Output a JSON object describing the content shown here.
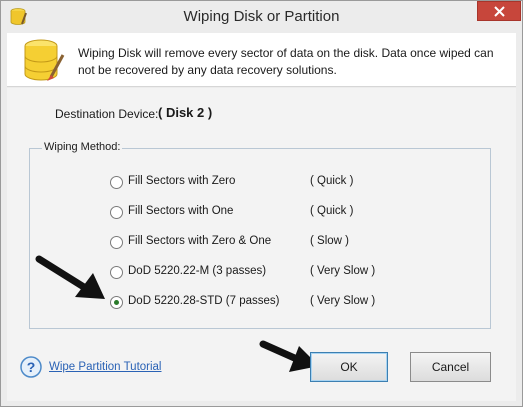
{
  "window": {
    "title": "Wiping Disk or Partition"
  },
  "header": {
    "description": "Wiping Disk will remove every sector of data on the disk. Data once wiped can not be recovered by any data recovery solutions."
  },
  "destination": {
    "label": "Destination Device:",
    "value": "( Disk 2 )"
  },
  "wiping_method": {
    "legend": "Wiping Method:",
    "options": [
      {
        "label": "Fill Sectors with Zero",
        "speed": "( Quick )",
        "selected": false
      },
      {
        "label": "Fill Sectors with One",
        "speed": "( Quick )",
        "selected": false
      },
      {
        "label": "Fill Sectors with Zero & One",
        "speed": "( Slow )",
        "selected": false
      },
      {
        "label": "DoD 5220.22-M (3 passes)",
        "speed": "( Very Slow )",
        "selected": false
      },
      {
        "label": "DoD 5220.28-STD (7 passes)",
        "speed": "( Very Slow )",
        "selected": true
      }
    ]
  },
  "footer": {
    "tutorial_link": "Wipe Partition Tutorial",
    "ok_label": "OK",
    "cancel_label": "Cancel"
  },
  "colors": {
    "close_button": "#c7463b",
    "link": "#2a62b5",
    "group_border": "#b9c7d4"
  }
}
